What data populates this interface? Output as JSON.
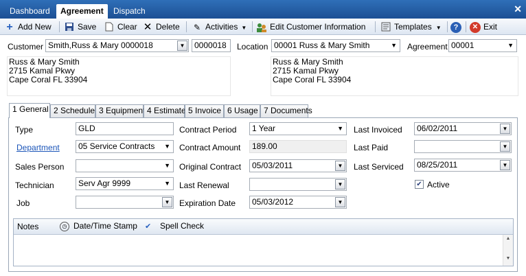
{
  "top_tabs": [
    "Dashboard",
    "Agreement",
    "Dispatch"
  ],
  "toolbar": {
    "add_new": "Add New",
    "save": "Save",
    "clear": "Clear",
    "delete": "Delete",
    "activities": "Activities",
    "edit_customer": "Edit Customer Information",
    "templates": "Templates",
    "exit": "Exit"
  },
  "header": {
    "customer_label": "Customer",
    "customer_value": "Smith,Russ & Mary 0000018",
    "customer_code": "0000018",
    "location_label": "Location",
    "location_value": "00001 Russ & Mary Smith",
    "agreement_label": "Agreement",
    "agreement_value": "00001",
    "customer_address": [
      "Russ & Mary Smith",
      "2715 Kamal Pkwy",
      "Cape Coral FL  33904"
    ],
    "location_address": [
      "Russ & Mary Smith",
      "2715 Kamal Pkwy",
      "Cape Coral  FL  33904"
    ]
  },
  "tabs": [
    "1 General",
    "2 Schedule",
    "3 Equipment",
    "4 Estimate",
    "5 Invoice",
    "6 Usage",
    "7 Documents"
  ],
  "general": {
    "type_label": "Type",
    "type_value": "GLD",
    "department_label": "Department",
    "department_value": "05 Service Contracts",
    "sales_person_label": "Sales Person",
    "sales_person_value": "",
    "technician_label": "Technician",
    "technician_value": "Serv Agr 9999",
    "job_label": "Job",
    "job_value": "",
    "contract_period_label": "Contract Period",
    "contract_period_value": "1 Year",
    "contract_amount_label": "Contract Amount",
    "contract_amount_value": "189.00",
    "original_contract_label": "Original Contract",
    "original_contract_value": "05/03/2011",
    "last_renewal_label": "Last Renewal",
    "last_renewal_value": "",
    "expiration_label": "Expiration Date",
    "expiration_value": "05/03/2012",
    "last_invoiced_label": "Last Invoiced",
    "last_invoiced_value": "06/02/2011",
    "last_paid_label": "Last Paid",
    "last_paid_value": "",
    "last_serviced_label": "Last Serviced",
    "last_serviced_value": "08/25/2011",
    "active_label": "Active",
    "active_checked": true
  },
  "notes": {
    "label": "Notes",
    "datetime": "Date/Time Stamp",
    "spell": "Spell Check"
  }
}
